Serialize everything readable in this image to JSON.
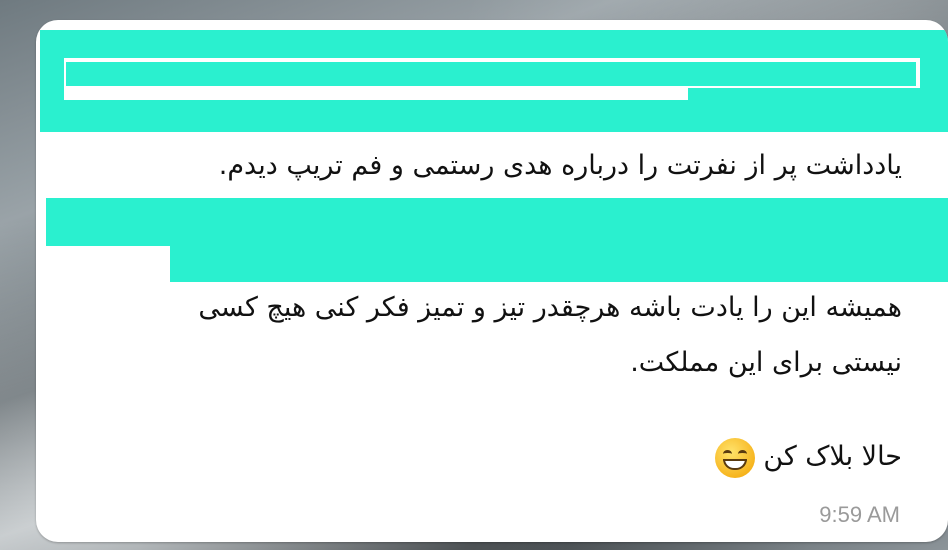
{
  "message": {
    "lines": [
      "یادداشت پر از نفرتت را درباره هدی رستمی و فم تریپ دیدم.",
      "همیشه این را یادت باشه هرچقدر تیز و تمیز فکر کنی  هیچ کسی",
      "نیستی برای این مملکت.",
      "حالا بلاک کن"
    ],
    "emoji": "grinning-face-with-smiling-eyes-icon",
    "time": "9:59 AM"
  },
  "colors": {
    "redaction": "#2af0cf",
    "bubble": "#ffffff",
    "text": "#111111",
    "timestamp": "#9a9a9a"
  }
}
